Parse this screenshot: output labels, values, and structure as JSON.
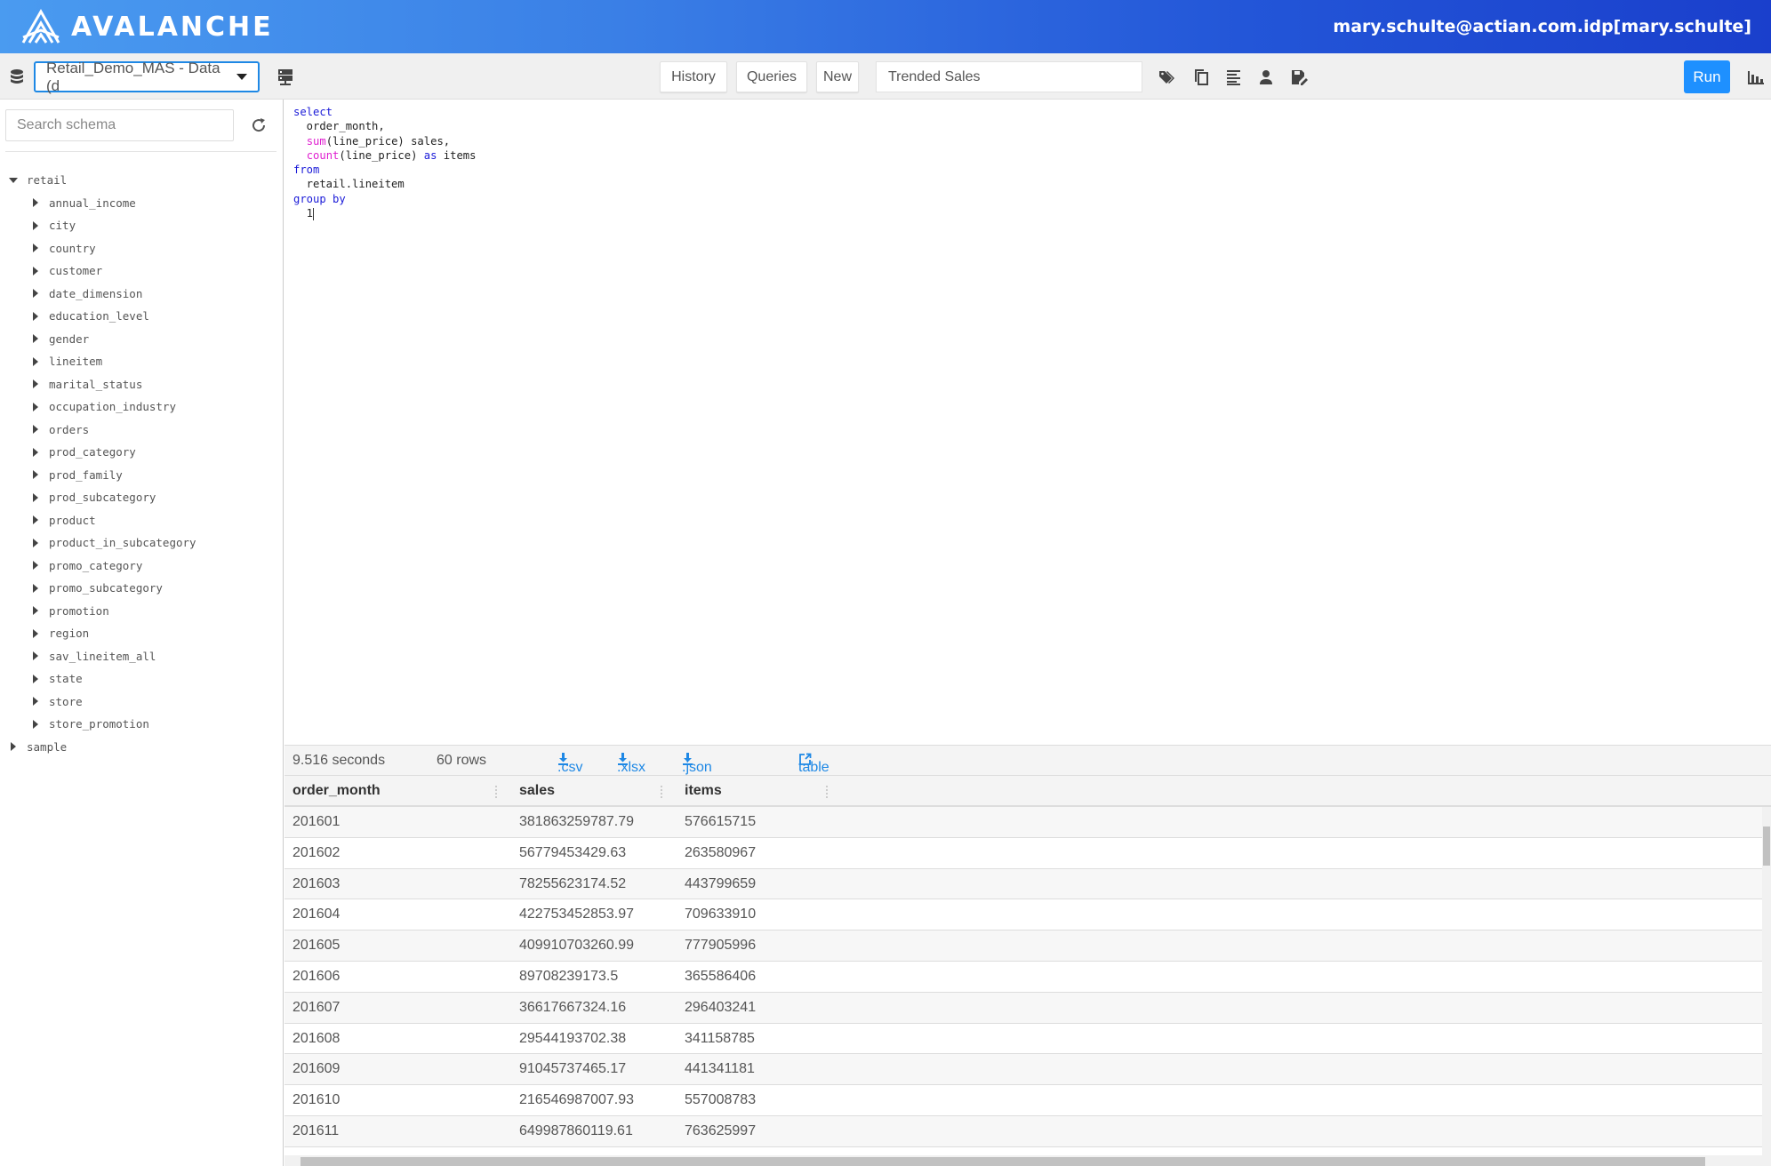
{
  "header": {
    "brand": "AVALANCHE",
    "user": "mary.schulte@actian.com.idp[mary.schulte]"
  },
  "toolbar": {
    "database_select": "Retail_Demo_MAS - Data (d",
    "history_label": "History",
    "queries_label": "Queries",
    "new_label": "New",
    "query_name": "Trended Sales",
    "run_label": "Run",
    "icons": [
      "database-icon",
      "server-icon",
      "tag-icon",
      "copy-icon",
      "format-icon",
      "user-icon",
      "save-icon",
      "chart-icon"
    ]
  },
  "sidebar": {
    "search_placeholder": "Search schema",
    "tree": [
      {
        "label": "retail",
        "expanded": true,
        "children": [
          "annual_income",
          "city",
          "country",
          "customer",
          "date_dimension",
          "education_level",
          "gender",
          "lineitem",
          "marital_status",
          "occupation_industry",
          "orders",
          "prod_category",
          "prod_family",
          "prod_subcategory",
          "product",
          "product_in_subcategory",
          "promo_category",
          "promo_subcategory",
          "promotion",
          "region",
          "sav_lineitem_all",
          "state",
          "store",
          "store_promotion"
        ]
      },
      {
        "label": "sample",
        "expanded": false,
        "children": []
      }
    ]
  },
  "editor": {
    "lines": [
      [
        {
          "t": "select",
          "c": "kw"
        }
      ],
      [
        {
          "t": "  order_month,",
          "c": ""
        }
      ],
      [
        {
          "t": "  ",
          "c": ""
        },
        {
          "t": "sum",
          "c": "fn"
        },
        {
          "t": "(line_price) sales,",
          "c": ""
        }
      ],
      [
        {
          "t": "  ",
          "c": ""
        },
        {
          "t": "count",
          "c": "fn"
        },
        {
          "t": "(line_price) ",
          "c": ""
        },
        {
          "t": "as",
          "c": "kw"
        },
        {
          "t": " items",
          "c": ""
        }
      ],
      [
        {
          "t": "from",
          "c": "kw"
        }
      ],
      [
        {
          "t": "  retail.lineitem",
          "c": ""
        }
      ],
      [
        {
          "t": "group by",
          "c": "kw"
        }
      ],
      [
        {
          "t": "  1",
          "c": ""
        }
      ]
    ]
  },
  "results": {
    "elapsed": "9.516 seconds",
    "row_count": "60 rows",
    "downloads": [
      ".csv",
      ".xlsx",
      ".json"
    ],
    "table_link": "table",
    "columns": [
      "order_month",
      "sales",
      "items"
    ],
    "rows": [
      [
        "201601",
        "381863259787.79",
        "576615715"
      ],
      [
        "201602",
        "56779453429.63",
        "263580967"
      ],
      [
        "201603",
        "78255623174.52",
        "443799659"
      ],
      [
        "201604",
        "422753452853.97",
        "709633910"
      ],
      [
        "201605",
        "409910703260.99",
        "777905996"
      ],
      [
        "201606",
        "89708239173.5",
        "365586406"
      ],
      [
        "201607",
        "36617667324.16",
        "296403241"
      ],
      [
        "201608",
        "29544193702.38",
        "341158785"
      ],
      [
        "201609",
        "91045737465.17",
        "441341181"
      ],
      [
        "201610",
        "216546987007.93",
        "557008783"
      ],
      [
        "201611",
        "649987860119.61",
        "763625997"
      ]
    ]
  },
  "colors": {
    "accent": "#1e90ff",
    "header_start": "#4a9bf0",
    "header_end": "#1a3fcc",
    "keyword": "#1b1bd8",
    "function": "#e020d0"
  }
}
